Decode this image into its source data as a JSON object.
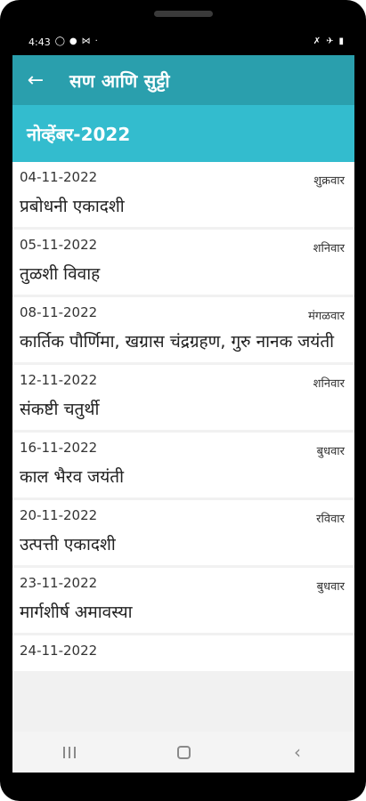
{
  "status_bar": {
    "time": "4:43",
    "left_icons": [
      "whatsapp-icon",
      "message-icon",
      "mail-icon",
      "dot-icon"
    ],
    "right_icons": [
      "mute-icon",
      "airplane-icon",
      "battery-icon"
    ]
  },
  "app_bar": {
    "title": "सण आणि सुट्टी",
    "back_icon": "arrow-left-icon"
  },
  "month_header": "नोव्हेंबर-2022",
  "items": [
    {
      "date": "04-11-2022",
      "day": "शुक्रवार",
      "name": "प्रबोधनी एकादशी"
    },
    {
      "date": "05-11-2022",
      "day": "शनिवार",
      "name": "तुळशी विवाह"
    },
    {
      "date": "08-11-2022",
      "day": "मंगळवार",
      "name": "कार्तिक पौर्णिमा, खग्रास चंद्रग्रहण, गुरु नानक जयंती"
    },
    {
      "date": "12-11-2022",
      "day": "शनिवार",
      "name": "संकष्टी चतुर्थी"
    },
    {
      "date": "16-11-2022",
      "day": "बुधवार",
      "name": "काल भैरव जयंती"
    },
    {
      "date": "20-11-2022",
      "day": "रविवार",
      "name": "उत्पत्ती एकादशी"
    },
    {
      "date": "23-11-2022",
      "day": "बुधवार",
      "name": "मार्गशीर्ष अमावस्या"
    },
    {
      "date": "24-11-2022",
      "day": "",
      "name": ""
    }
  ],
  "colors": {
    "app_bar": "#2a9fad",
    "month_header": "#33bcce",
    "background": "#f1f1f1"
  },
  "nav_bar": {
    "icons": [
      "recents-icon",
      "home-icon",
      "back-icon"
    ]
  }
}
